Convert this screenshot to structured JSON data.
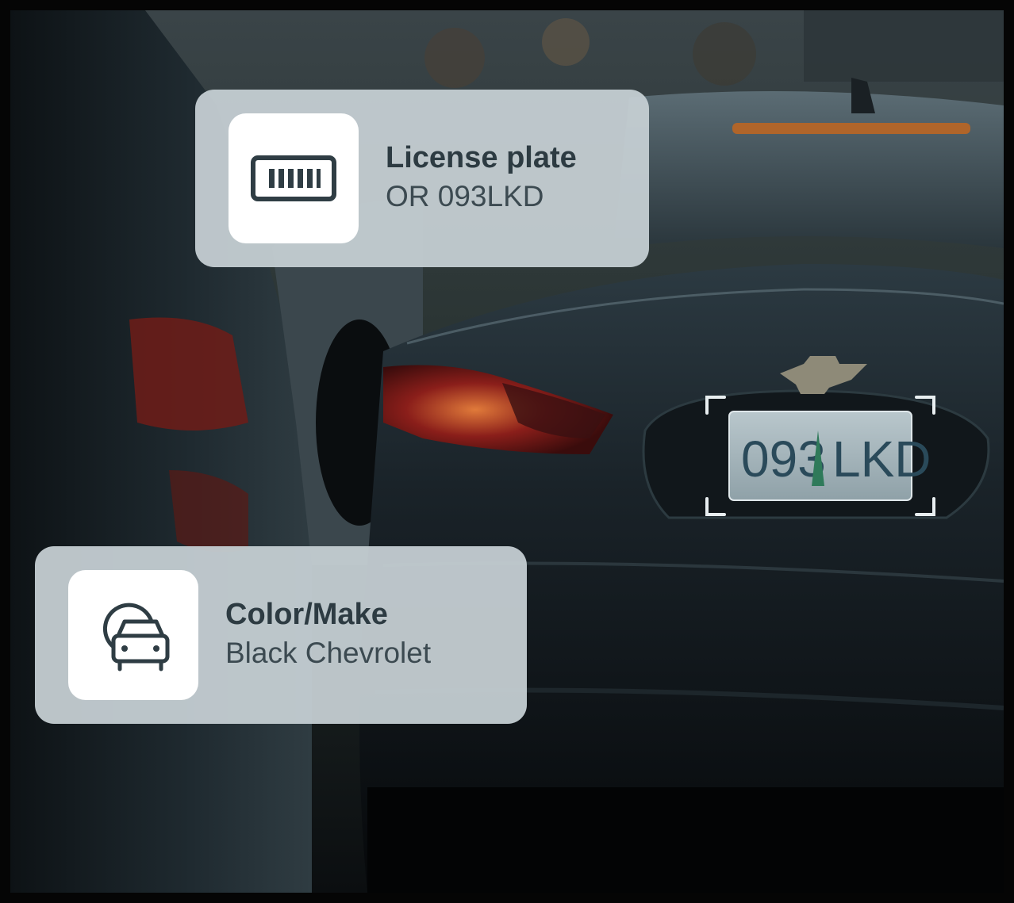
{
  "cards": {
    "license_plate": {
      "title": "License plate",
      "value": "OR 093LKD",
      "icon": "license-plate-icon"
    },
    "color_make": {
      "title": "Color/Make",
      "value": "Black Chevrolet",
      "icon": "car-color-icon"
    }
  },
  "plate": {
    "text": "093LKD"
  },
  "colors": {
    "card_bg": "#c6cfd3",
    "title_text": "#2d3b42",
    "value_text": "#3c4a51",
    "car_body": "#0e1114",
    "tail_light": "#8a1e1a"
  }
}
